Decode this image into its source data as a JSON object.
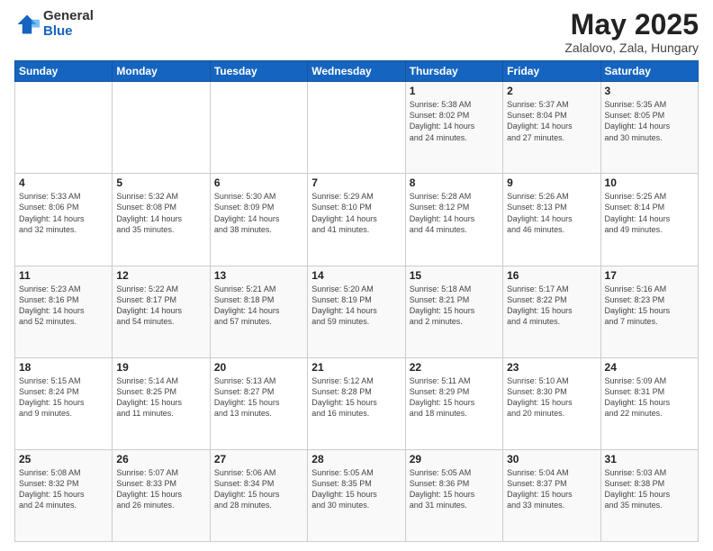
{
  "logo": {
    "general": "General",
    "blue": "Blue"
  },
  "title": "May 2025",
  "subtitle": "Zalalovo, Zala, Hungary",
  "headers": [
    "Sunday",
    "Monday",
    "Tuesday",
    "Wednesday",
    "Thursday",
    "Friday",
    "Saturday"
  ],
  "weeks": [
    [
      {
        "day": "",
        "info": ""
      },
      {
        "day": "",
        "info": ""
      },
      {
        "day": "",
        "info": ""
      },
      {
        "day": "",
        "info": ""
      },
      {
        "day": "1",
        "info": "Sunrise: 5:38 AM\nSunset: 8:02 PM\nDaylight: 14 hours\nand 24 minutes."
      },
      {
        "day": "2",
        "info": "Sunrise: 5:37 AM\nSunset: 8:04 PM\nDaylight: 14 hours\nand 27 minutes."
      },
      {
        "day": "3",
        "info": "Sunrise: 5:35 AM\nSunset: 8:05 PM\nDaylight: 14 hours\nand 30 minutes."
      }
    ],
    [
      {
        "day": "4",
        "info": "Sunrise: 5:33 AM\nSunset: 8:06 PM\nDaylight: 14 hours\nand 32 minutes."
      },
      {
        "day": "5",
        "info": "Sunrise: 5:32 AM\nSunset: 8:08 PM\nDaylight: 14 hours\nand 35 minutes."
      },
      {
        "day": "6",
        "info": "Sunrise: 5:30 AM\nSunset: 8:09 PM\nDaylight: 14 hours\nand 38 minutes."
      },
      {
        "day": "7",
        "info": "Sunrise: 5:29 AM\nSunset: 8:10 PM\nDaylight: 14 hours\nand 41 minutes."
      },
      {
        "day": "8",
        "info": "Sunrise: 5:28 AM\nSunset: 8:12 PM\nDaylight: 14 hours\nand 44 minutes."
      },
      {
        "day": "9",
        "info": "Sunrise: 5:26 AM\nSunset: 8:13 PM\nDaylight: 14 hours\nand 46 minutes."
      },
      {
        "day": "10",
        "info": "Sunrise: 5:25 AM\nSunset: 8:14 PM\nDaylight: 14 hours\nand 49 minutes."
      }
    ],
    [
      {
        "day": "11",
        "info": "Sunrise: 5:23 AM\nSunset: 8:16 PM\nDaylight: 14 hours\nand 52 minutes."
      },
      {
        "day": "12",
        "info": "Sunrise: 5:22 AM\nSunset: 8:17 PM\nDaylight: 14 hours\nand 54 minutes."
      },
      {
        "day": "13",
        "info": "Sunrise: 5:21 AM\nSunset: 8:18 PM\nDaylight: 14 hours\nand 57 minutes."
      },
      {
        "day": "14",
        "info": "Sunrise: 5:20 AM\nSunset: 8:19 PM\nDaylight: 14 hours\nand 59 minutes."
      },
      {
        "day": "15",
        "info": "Sunrise: 5:18 AM\nSunset: 8:21 PM\nDaylight: 15 hours\nand 2 minutes."
      },
      {
        "day": "16",
        "info": "Sunrise: 5:17 AM\nSunset: 8:22 PM\nDaylight: 15 hours\nand 4 minutes."
      },
      {
        "day": "17",
        "info": "Sunrise: 5:16 AM\nSunset: 8:23 PM\nDaylight: 15 hours\nand 7 minutes."
      }
    ],
    [
      {
        "day": "18",
        "info": "Sunrise: 5:15 AM\nSunset: 8:24 PM\nDaylight: 15 hours\nand 9 minutes."
      },
      {
        "day": "19",
        "info": "Sunrise: 5:14 AM\nSunset: 8:25 PM\nDaylight: 15 hours\nand 11 minutes."
      },
      {
        "day": "20",
        "info": "Sunrise: 5:13 AM\nSunset: 8:27 PM\nDaylight: 15 hours\nand 13 minutes."
      },
      {
        "day": "21",
        "info": "Sunrise: 5:12 AM\nSunset: 8:28 PM\nDaylight: 15 hours\nand 16 minutes."
      },
      {
        "day": "22",
        "info": "Sunrise: 5:11 AM\nSunset: 8:29 PM\nDaylight: 15 hours\nand 18 minutes."
      },
      {
        "day": "23",
        "info": "Sunrise: 5:10 AM\nSunset: 8:30 PM\nDaylight: 15 hours\nand 20 minutes."
      },
      {
        "day": "24",
        "info": "Sunrise: 5:09 AM\nSunset: 8:31 PM\nDaylight: 15 hours\nand 22 minutes."
      }
    ],
    [
      {
        "day": "25",
        "info": "Sunrise: 5:08 AM\nSunset: 8:32 PM\nDaylight: 15 hours\nand 24 minutes."
      },
      {
        "day": "26",
        "info": "Sunrise: 5:07 AM\nSunset: 8:33 PM\nDaylight: 15 hours\nand 26 minutes."
      },
      {
        "day": "27",
        "info": "Sunrise: 5:06 AM\nSunset: 8:34 PM\nDaylight: 15 hours\nand 28 minutes."
      },
      {
        "day": "28",
        "info": "Sunrise: 5:05 AM\nSunset: 8:35 PM\nDaylight: 15 hours\nand 30 minutes."
      },
      {
        "day": "29",
        "info": "Sunrise: 5:05 AM\nSunset: 8:36 PM\nDaylight: 15 hours\nand 31 minutes."
      },
      {
        "day": "30",
        "info": "Sunrise: 5:04 AM\nSunset: 8:37 PM\nDaylight: 15 hours\nand 33 minutes."
      },
      {
        "day": "31",
        "info": "Sunrise: 5:03 AM\nSunset: 8:38 PM\nDaylight: 15 hours\nand 35 minutes."
      }
    ]
  ]
}
